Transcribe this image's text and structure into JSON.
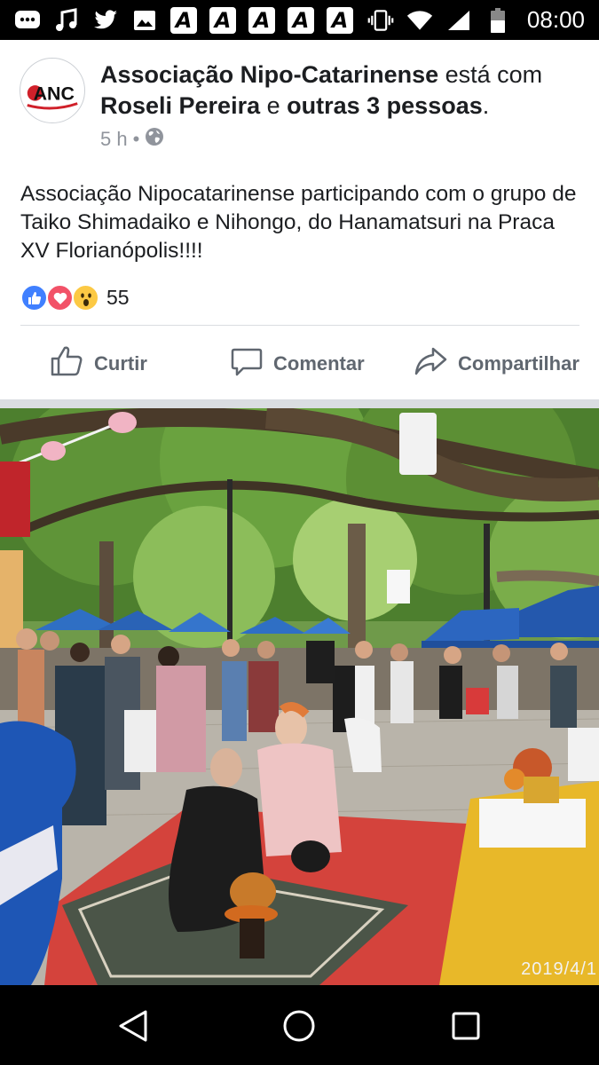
{
  "status_bar": {
    "time": "08:00",
    "a_icon_letter": "A",
    "icons": [
      "chat-icon",
      "music-icon",
      "twitter-icon",
      "image-icon",
      "a-app-icon",
      "a-app-icon",
      "a-app-icon",
      "a-app-icon",
      "a-app-icon",
      "vibrate-icon",
      "wifi-icon",
      "signal-icon",
      "battery-icon"
    ]
  },
  "post": {
    "author": "Associação Nipo-Catarinense",
    "with_text": " está com ",
    "tagged_person": "Roseli Pereira",
    "and_text": " e ",
    "others": "outras 3 pessoas",
    "period": ".",
    "time_ago": "5 h",
    "separator": "•",
    "privacy_icon": "globe-icon",
    "avatar_text": "ANC",
    "body": "Associação Nipocatarinense participando com o grupo de Taiko Shimadaiko e Nihongo, do Hanamatsuri na Praca XV Florianópolis!!!!",
    "reactions": {
      "types": [
        "like",
        "love",
        "wow"
      ],
      "count": "55"
    },
    "actions": {
      "like": "Curtir",
      "comment": "Comentar",
      "share": "Compartilhar"
    }
  },
  "photo": {
    "date_stamp": "2019/4/1"
  },
  "nav_bar": {
    "buttons": [
      "back-icon",
      "home-icon",
      "recents-icon"
    ]
  },
  "colors": {
    "like_blue": "#4080ff",
    "love_red": "#f25268",
    "wow_yellow": "#fcc944",
    "action_gray": "#606770",
    "meta_gray": "#90949c",
    "separator_gray": "#dadde1"
  }
}
